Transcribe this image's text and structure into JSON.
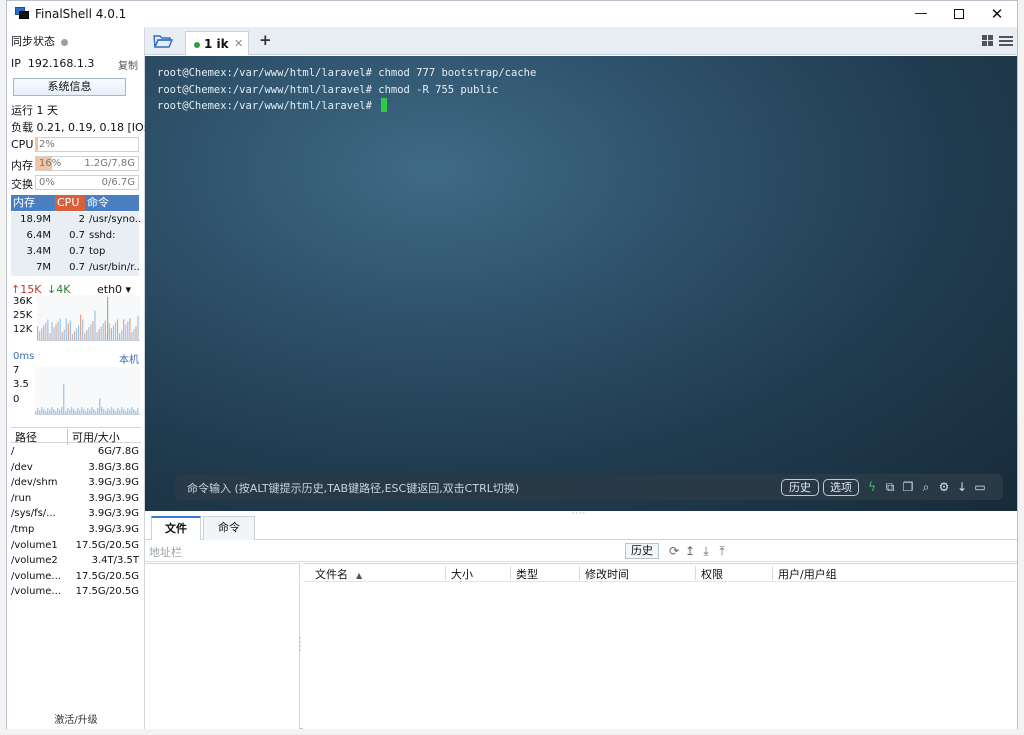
{
  "window": {
    "title": "FinalShell 4.0.1",
    "controls": {
      "minimize": "—",
      "maximize": "",
      "close": "✕"
    }
  },
  "sidebar": {
    "sync_status_label": "同步状态",
    "ip_label": "IP",
    "ip_value": "192.168.1.3",
    "copy_label": "复制",
    "sysinfo_button": "系统信息",
    "uptime": "运行 1 天",
    "load": "负载 0.21, 0.19, 0.18 [IO:...",
    "cpu": {
      "label": "CPU",
      "percent": "2%",
      "value": 0.02
    },
    "memory": {
      "label": "内存",
      "percent": "16%",
      "value": 0.16,
      "usage": "1.2G/7.8G"
    },
    "swap": {
      "label": "交换",
      "percent": "0%",
      "value": 0.0,
      "usage": "0/6.7G"
    },
    "process_headers": {
      "mem": "内存",
      "cpu": "CPU",
      "cmd": "命令"
    },
    "processes": [
      {
        "mem": "18.9M",
        "cpu": "2",
        "cmd": "/usr/syno..."
      },
      {
        "mem": "6.4M",
        "cpu": "0.7",
        "cmd": "sshd:"
      },
      {
        "mem": "3.4M",
        "cpu": "0.7",
        "cmd": "top"
      },
      {
        "mem": "7M",
        "cpu": "0.7",
        "cmd": "/usr/bin/r..."
      }
    ],
    "network": {
      "up": "↑15K",
      "down": "↓4K",
      "interface": "eth0 ▾",
      "axis": [
        "36K",
        "25K",
        "12K"
      ]
    },
    "ping": {
      "latency": "0ms",
      "host": "本机",
      "axis": [
        "7",
        "3.5",
        "0"
      ]
    },
    "disk_headers": {
      "path": "路径",
      "size": "可用/大小"
    },
    "disks": [
      {
        "path": "/",
        "size": "6G/7.8G"
      },
      {
        "path": "/dev",
        "size": "3.8G/3.8G"
      },
      {
        "path": "/dev/shm",
        "size": "3.9G/3.9G"
      },
      {
        "path": "/run",
        "size": "3.9G/3.9G"
      },
      {
        "path": "/sys/fs/...",
        "size": "3.9G/3.9G"
      },
      {
        "path": "/tmp",
        "size": "3.9G/3.9G"
      },
      {
        "path": "/volume1",
        "size": "17.5G/20.5G"
      },
      {
        "path": "/volume2",
        "size": "3.4T/3.5T"
      },
      {
        "path": "/volume...",
        "size": "17.5G/20.5G"
      },
      {
        "path": "/volume...",
        "size": "17.5G/20.5G"
      }
    ],
    "activate": "激活/升级"
  },
  "tabs": {
    "items": [
      {
        "label": "1 ik",
        "close": "✕"
      }
    ],
    "add": "+"
  },
  "terminal": {
    "lines": [
      "root@Chemex:/var/www/html/laravel# chmod 777 bootstrap/cache",
      "root@Chemex:/var/www/html/laravel# chmod -R 755 public",
      "root@Chemex:/var/www/html/laravel# "
    ],
    "command_hint": "命令输入 (按ALT键提示历史,TAB键路径,ESC键返回,双击CTRL切换)",
    "history_button": "历史",
    "options_button": "选项"
  },
  "files": {
    "tabs": [
      "文件",
      "命令"
    ],
    "address_placeholder": "地址栏",
    "history_button": "历史",
    "columns": [
      "文件名",
      "大小",
      "类型",
      "修改时间",
      "权限",
      "用户/用户组"
    ]
  },
  "colors": {
    "accent": "#3a7bd5",
    "cpu_header": "#d9603b",
    "mem_header": "#4a7fc1",
    "cursor": "#2ecc40",
    "terminal_bg": "#2a4a62"
  }
}
